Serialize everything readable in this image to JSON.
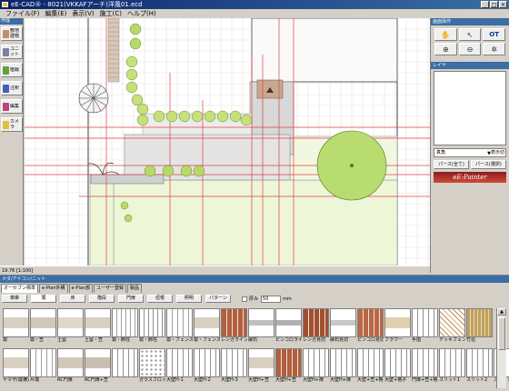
{
  "window": {
    "title": "eE-CAD® - 8021(VKKAFアーチ)洋風01.ecd"
  },
  "menu": [
    "ファイル(F)",
    "編集(E)",
    "表示(V)",
    "施工(C)",
    "ヘルプ(H)"
  ],
  "left_toolbar": {
    "header": "作成",
    "tools": [
      {
        "label": "敷地建物",
        "icon_color": "#c09060",
        "icon": "house-icon"
      },
      {
        "label": "ユニット",
        "icon_color": "#8080a0",
        "icon": "unit-icon"
      },
      {
        "label": "植栽",
        "icon_color": "#60a040",
        "icon": "plant-icon"
      },
      {
        "label": "注釈",
        "icon_color": "#4060c0",
        "icon": "annotation-icon"
      },
      {
        "label": "編集",
        "icon_color": "#c04080",
        "icon": "edit-icon"
      },
      {
        "label": "カメラ",
        "icon_color": "#e0c040",
        "icon": "camera-icon"
      }
    ]
  },
  "status": {
    "coords": "19.76 [1:100]"
  },
  "right_panel": {
    "view_ops_title": "画面操作",
    "view_tools": [
      {
        "glyph": "✋",
        "icon": "hand-pan-icon"
      },
      {
        "glyph": "↖",
        "icon": "pointer-icon"
      },
      {
        "glyph": "OT",
        "icon": "ot-icon"
      },
      {
        "glyph": "⊕",
        "icon": "zoom-in-icon"
      },
      {
        "glyph": "⊖",
        "icon": "zoom-out-icon"
      },
      {
        "glyph": "✲",
        "icon": "gear-icon"
      }
    ],
    "layer_title": "レイヤ",
    "view_dropdown": "真角",
    "view_dropdown_side": "表示切",
    "perspective_all": "パース(全て)",
    "perspective_select": "パース(選択)",
    "logo_text": "eE-Painter"
  },
  "bottom_panel": {
    "title": "メタ/アイコン/ニット",
    "main_tabs": [
      "オーセブン標準",
      "e-Plan外構",
      "e-Plan部",
      "ユーザー登録",
      "製品"
    ],
    "sub_tabs": [
      "車庫",
      "塀",
      "床",
      "階段",
      "門扉",
      "垣根",
      "照明",
      "パターン"
    ],
    "thickness_label": "厚み",
    "thickness_value": "50",
    "thickness_unit": "mm",
    "thumbnails": [
      {
        "caption": "塀",
        "type": "wall",
        "color": "#d8d0c0"
      },
      {
        "caption": "塀・笠",
        "type": "wall",
        "color": "#d0c8b8"
      },
      {
        "caption": "土留",
        "type": "wall",
        "color": "#e0d8c8"
      },
      {
        "caption": "土留・笠",
        "type": "wall",
        "color": "#d8d0c0"
      },
      {
        "caption": "塀・飾柱",
        "type": "rail",
        "color": "#a0a0a0"
      },
      {
        "caption": "塀・飾柱",
        "type": "rail",
        "color": "#909090"
      },
      {
        "caption": "塀・フェンス",
        "type": "frame",
        "color": "#a0a0a0"
      },
      {
        "caption": "塀・フェンス",
        "type": "wall",
        "color": "#d8d0c0"
      },
      {
        "caption": "レンガライン",
        "type": "brick",
        "color": "#b06040"
      },
      {
        "caption": "縁石",
        "type": "curb",
        "color": "#c0c0c0"
      },
      {
        "caption": "ピンコロライン",
        "type": "curb",
        "color": "#b0b0b0"
      },
      {
        "caption": "レンガ見切",
        "type": "brick",
        "color": "#a05030"
      },
      {
        "caption": "縁石見切",
        "type": "curb",
        "color": "#c8c8c8"
      },
      {
        "caption": "ピンコロ見切",
        "type": "brick",
        "color": "#b86848"
      },
      {
        "caption": "フラワー",
        "type": "wall",
        "color": "#e0d0b0"
      },
      {
        "caption": "手摺",
        "type": "frame",
        "color": "#909090"
      },
      {
        "caption": "デッキフェンス",
        "type": "lattice",
        "color": "#c09050"
      },
      {
        "caption": "竹垣",
        "type": "bamboo",
        "color": "#c0a060"
      },
      {
        "caption": "ヤマザ(縦横)",
        "type": "wall",
        "color": "#d8d0c0"
      },
      {
        "caption": "片端",
        "type": "frame",
        "color": "#a0a0a0"
      },
      {
        "caption": "RC門扉",
        "type": "wall",
        "color": "#d0c8b8"
      },
      {
        "caption": "RC門扉+笠",
        "type": "wall",
        "color": "#c8c0b0"
      },
      {
        "caption": "",
        "type": "frame",
        "color": "#909090"
      },
      {
        "caption": "ガラスブロック",
        "type": "dots",
        "color": "#a0a0a0"
      },
      {
        "caption": "大壁H-1",
        "type": "frame",
        "color": "#909090"
      },
      {
        "caption": "大壁H-2",
        "type": "frame",
        "color": "#909090"
      },
      {
        "caption": "大壁H-3",
        "type": "frame",
        "color": "#909090"
      },
      {
        "caption": "大壁H+笠",
        "type": "wall",
        "color": "#d8d0c0"
      },
      {
        "caption": "大壁H+笠",
        "type": "brick",
        "color": "#b06040"
      },
      {
        "caption": "大壁H+扉",
        "type": "frame",
        "color": "#909090"
      },
      {
        "caption": "大壁H+扉",
        "type": "frame",
        "color": "#909090"
      },
      {
        "caption": "大壁+笠+格子",
        "type": "frame",
        "color": "#909090"
      },
      {
        "caption": "大壁+格子",
        "type": "frame",
        "color": "#909090"
      },
      {
        "caption": "門扉+笠+格子",
        "type": "frame",
        "color": "#909090"
      },
      {
        "caption": "スリット1",
        "type": "frame",
        "color": "#909090"
      },
      {
        "caption": "スリット2",
        "type": "frame",
        "color": "#909090"
      },
      {
        "caption": "スリット3",
        "type": "frame",
        "color": "#909090"
      }
    ]
  }
}
